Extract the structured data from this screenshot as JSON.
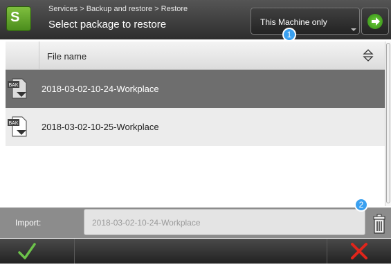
{
  "header": {
    "breadcrumb": "Services > Backup and restore > Restore",
    "title": "Select package to restore",
    "filter_dropdown": {
      "selected": "This Machine only"
    },
    "badge_filter": "1"
  },
  "table": {
    "columns": [
      "File name"
    ],
    "rows": [
      {
        "icon": "bak-file-icon",
        "name": "2018-03-02-10-24-Workplace",
        "selected": true
      },
      {
        "icon": "bak-file-icon",
        "name": "2018-03-02-10-25-Workplace",
        "selected": false
      }
    ]
  },
  "import": {
    "label": "Import:",
    "value": "2018-03-02-10-24-Workplace",
    "badge_delete": "2"
  },
  "icons": {
    "app": "app-logo-icon",
    "go": "arrow-right-icon",
    "sort": "sort-icon",
    "delete": "trash-icon",
    "ok": "check-icon",
    "cancel": "close-icon"
  },
  "colors": {
    "accent_green": "#4b8d1d",
    "selected_row": "#6e6e6e",
    "badge": "#3aa0f0",
    "cancel_red": "#e0251b"
  }
}
